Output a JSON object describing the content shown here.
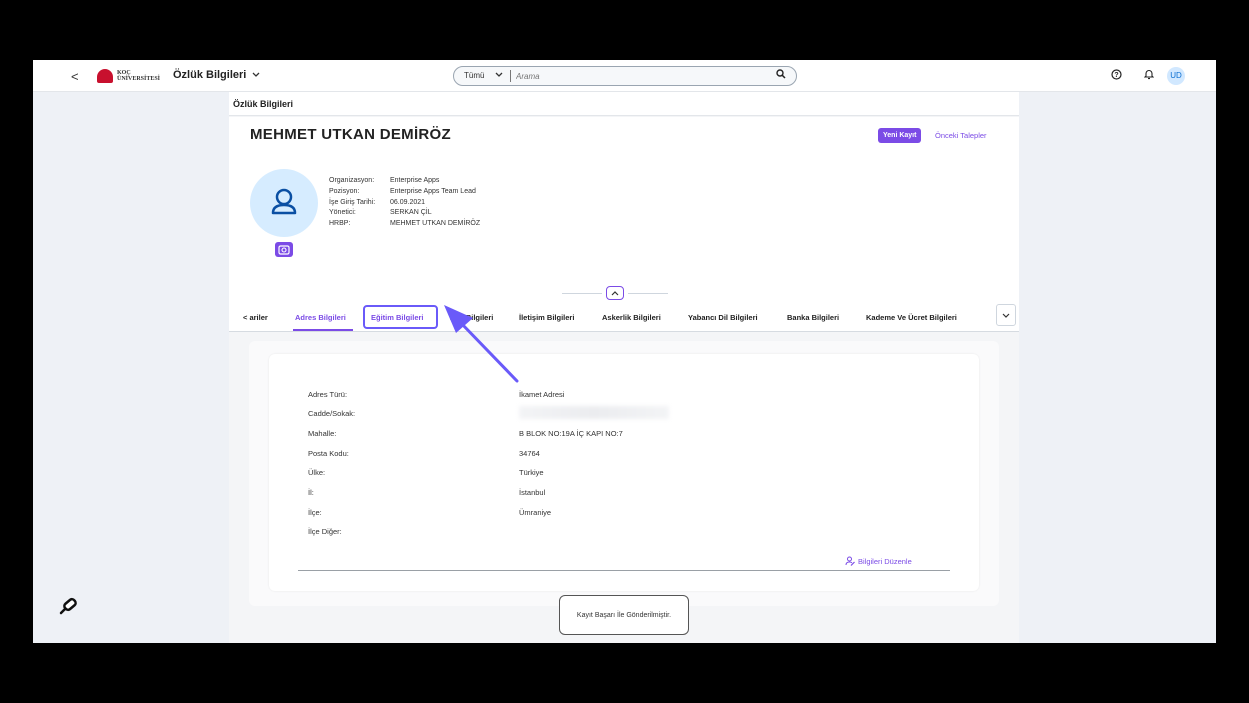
{
  "shell": {
    "back_glyph": "<",
    "logo_text_1": "KOÇ",
    "logo_text_2": "ÜNİVERSİTESİ",
    "app_title": "Özlük Bilgileri",
    "search_scope": "Tümü",
    "search_placeholder": "Arama",
    "user_initials": "UD"
  },
  "page": {
    "header_title": "Özlük Bilgileri",
    "person_name": "MEHMET UTKAN DEMİRÖZ",
    "new_record_label": "Yeni Kayıt",
    "previous_requests_label": "Önceki Talepler",
    "info": [
      {
        "label": "Organizasyon:",
        "value": "Enterprise Apps"
      },
      {
        "label": "Pozisyon:",
        "value": "Enterprise Apps Team Lead"
      },
      {
        "label": "İşe Giriş Tarihi:",
        "value": "06.09.2021"
      },
      {
        "label": "Yönetici:",
        "value": "SERKAN ÇİL"
      },
      {
        "label": "HRBP:",
        "value": "MEHMET UTKAN DEMİRÖZ"
      }
    ]
  },
  "tabs": [
    {
      "label": "< ariler"
    },
    {
      "label": "Adres Bilgileri"
    },
    {
      "label": "Eğitim Bilgileri"
    },
    {
      "label": "Aile Bilgileri"
    },
    {
      "label": "İletişim Bilgileri"
    },
    {
      "label": "Askerlik Bilgileri"
    },
    {
      "label": "Yabancı Dil Bilgileri"
    },
    {
      "label": "Banka Bilgileri"
    },
    {
      "label": "Kademe Ve Ücret Bilgileri"
    }
  ],
  "address": {
    "fields": [
      {
        "label": "Adres Türü:",
        "value": "İkamet Adresi"
      },
      {
        "label": "Cadde/Sokak:",
        "value": ""
      },
      {
        "label": "Mahalle:",
        "value": "B BLOK NO:19A İÇ KAPI NO:7"
      },
      {
        "label": "Posta Kodu:",
        "value": "34764"
      },
      {
        "label": "Ülke:",
        "value": "Türkiye"
      },
      {
        "label": "İl:",
        "value": "İstanbul"
      },
      {
        "label": "İlçe:",
        "value": "Ümraniye"
      },
      {
        "label": "İlçe Diğer:",
        "value": ""
      }
    ],
    "edit_label": "Bilgileri Düzenle"
  },
  "toast": {
    "message": "Kayıt Başarı İle Gönderilmiştir."
  },
  "colors": {
    "accent": "#7b4be6",
    "annotation_arrow": "#6a5af9"
  },
  "icons": [
    "search-icon",
    "help-icon",
    "bell-icon",
    "user-icon",
    "camera-icon",
    "chevron-up-icon",
    "chevron-down-icon",
    "edit-user-icon",
    "pin-icon"
  ]
}
